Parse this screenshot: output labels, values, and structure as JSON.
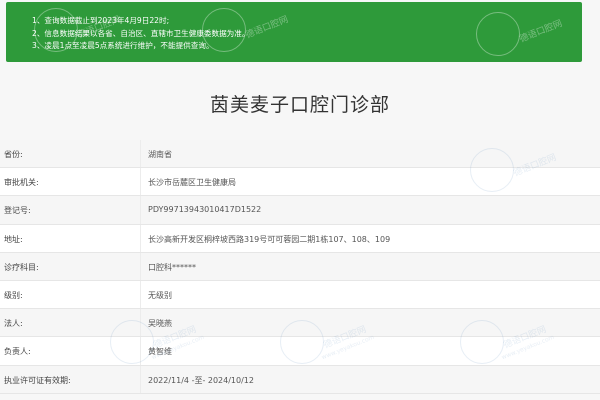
{
  "notice": {
    "lines": [
      "1、查询数据截止到2023年4月9日22时;",
      "2、信息数据结果以各省、自治区、直辖市卫生健康委数据为准。",
      "3、凌晨1点至凌晨5点系统进行维护，不能提供查询。"
    ],
    "background": "#2e9a3a"
  },
  "title": "茵美麦子口腔门诊部",
  "records": [
    {
      "label": "省份:",
      "value": "湖南省"
    },
    {
      "label": "审批机关:",
      "value": "长沙市岳麓区卫生健康局"
    },
    {
      "label": "登记号:",
      "value": "PDY99713943010417D1522"
    },
    {
      "label": "地址:",
      "value": "长沙高新开发区桐梓坡西路319号可可蓉园二期1栋107、108、109"
    },
    {
      "label": "诊疗科目:",
      "value": "口腔科******"
    },
    {
      "label": "级别:",
      "value": "无级别"
    },
    {
      "label": "法人:",
      "value": "吴晓燕"
    },
    {
      "label": "负责人:",
      "value": "黄智维"
    },
    {
      "label": "执业许可证有效期:",
      "value": "2022/11/4 -至- 2024/10/12"
    }
  ],
  "watermark": {
    "text": "德语口腔网",
    "subtext": "www.yeyakou.com"
  }
}
